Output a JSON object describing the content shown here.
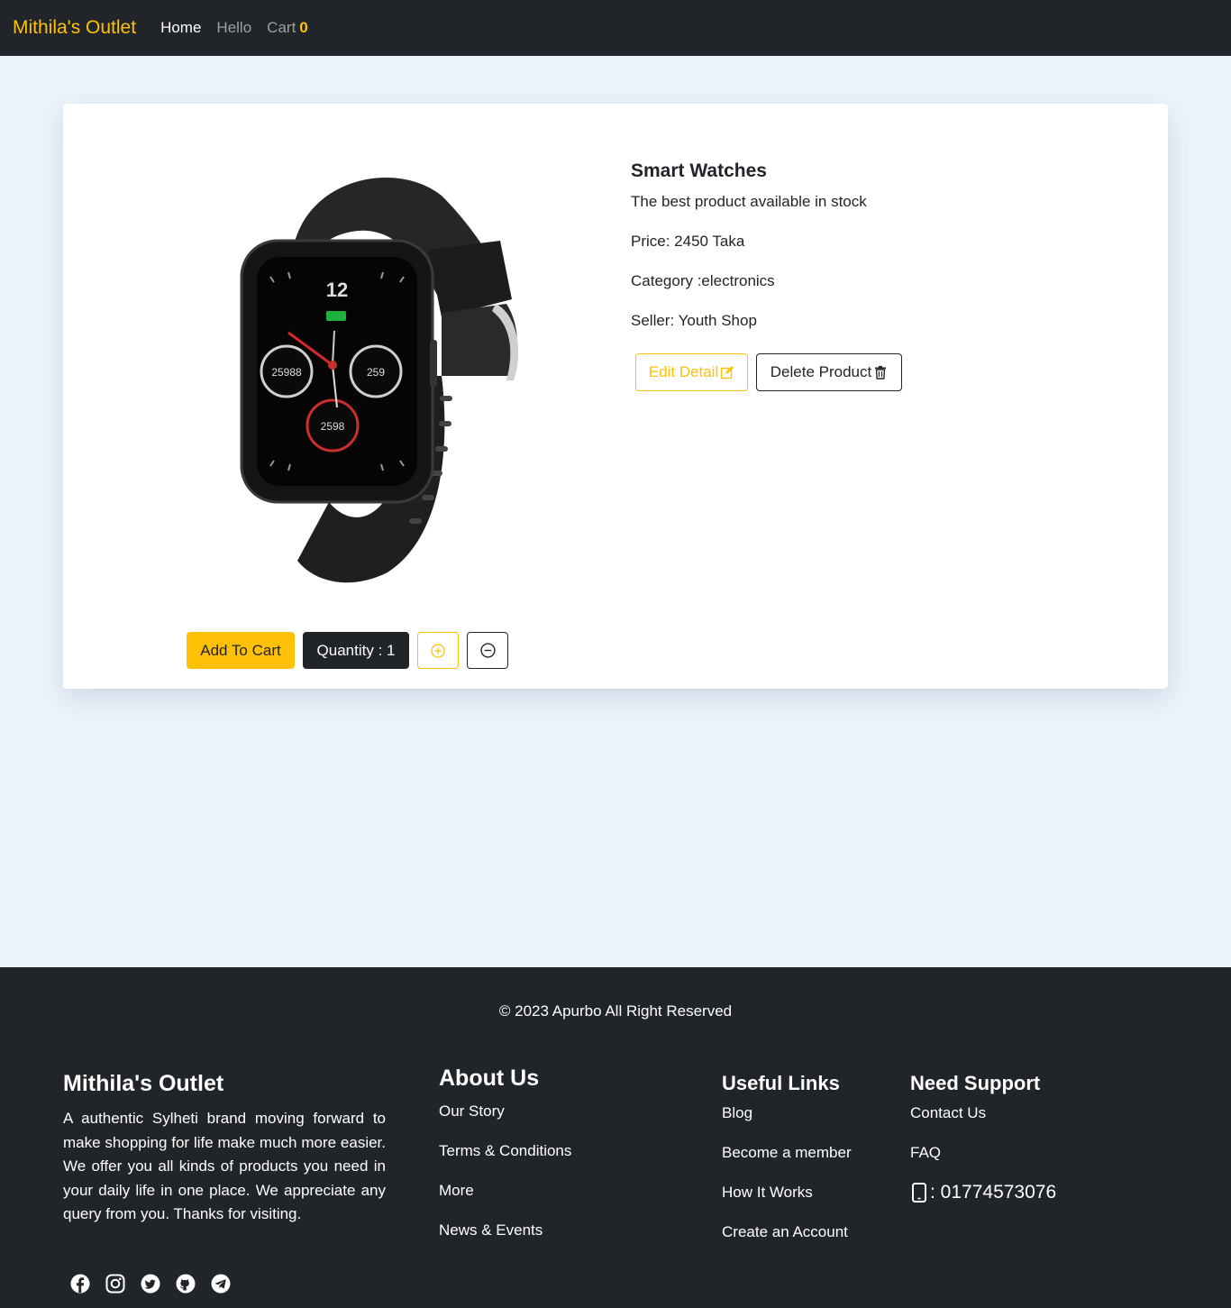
{
  "navbar": {
    "brand": "Mithila's Outlet",
    "home": "Home",
    "hello": "Hello",
    "cart_label": "Cart",
    "cart_count": "0"
  },
  "product": {
    "name": "Smart Watches",
    "description": "The best product available in stock",
    "price": "Price: 2450 Taka",
    "category": "Category :electronics",
    "seller": "Seller: Youth Shop",
    "edit_label": "Edit Detail",
    "delete_label": "Delete Product",
    "add_to_cart_label": "Add To Cart",
    "quantity_label": "Quantity : 1",
    "watch_face": {
      "time": "12",
      "left_dial": "25988",
      "right_dial": "259",
      "bottom_dial": "2598"
    }
  },
  "footer": {
    "copyright": "© 2023 Apurbo All Right Reserved",
    "brand": "Mithila's Outlet",
    "description": "A authentic Sylheti brand moving forward to make shopping for life make much more easier. We offer you all kinds of products you need in your daily life in one place. We appreciate any query from you. Thanks for visiting.",
    "about": {
      "title": "About Us",
      "links": [
        "Our Story",
        "Terms & Conditions",
        "More",
        "News & Events"
      ]
    },
    "useful": {
      "title": "Useful Links",
      "links": [
        "Blog",
        "Become a member",
        "How It Works",
        "Create an Account"
      ]
    },
    "support": {
      "title": "Need Support",
      "links": [
        "Contact Us",
        "FAQ"
      ],
      "phone": ": 01774573076"
    },
    "socials": [
      "facebook-icon",
      "instagram-icon",
      "twitter-icon",
      "github-icon",
      "telegram-icon"
    ]
  },
  "colors": {
    "accent": "#ffc107",
    "dark": "#212529",
    "background": "#edf3fb"
  }
}
